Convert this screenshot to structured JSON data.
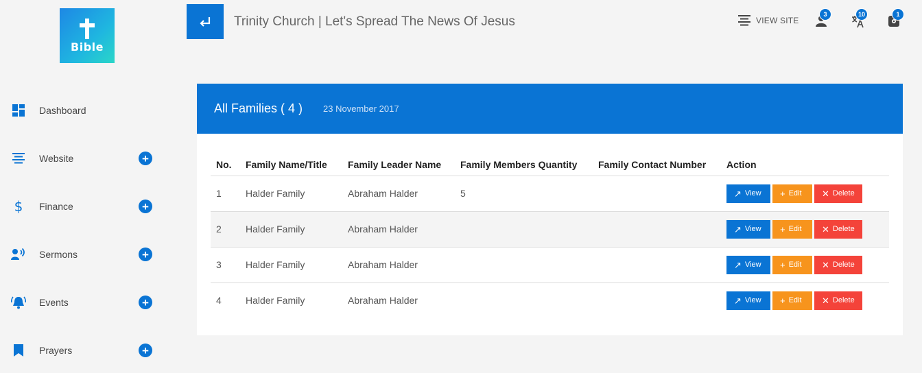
{
  "logo": {
    "text": "Bible"
  },
  "header": {
    "title": "Trinity Church | Let's Spread The News Of Jesus",
    "view_site": "VIEW SITE",
    "badges": {
      "users": "3",
      "translate": "10",
      "settings": "1"
    }
  },
  "sidebar": {
    "items": [
      {
        "label": "Dashboard",
        "icon": "dashboard-icon",
        "has_add": false
      },
      {
        "label": "Website",
        "icon": "align-center-icon",
        "has_add": true
      },
      {
        "label": "Finance",
        "icon": "dollar-icon",
        "has_add": true
      },
      {
        "label": "Sermons",
        "icon": "speaker-icon",
        "has_add": true
      },
      {
        "label": "Events",
        "icon": "alarm-bell-icon",
        "has_add": true
      },
      {
        "label": "Prayers",
        "icon": "bookmark-icon",
        "has_add": true
      }
    ]
  },
  "card": {
    "title": "All Families ( 4 )",
    "date": "23 November 2017"
  },
  "table": {
    "headers": [
      "No.",
      "Family Name/Title",
      "Family Leader Name",
      "Family Members Quantity",
      "Family Contact Number",
      "Action"
    ],
    "rows": [
      {
        "no": "1",
        "name": "Halder Family",
        "leader": "Abraham Halder",
        "qty": "5",
        "contact": ""
      },
      {
        "no": "2",
        "name": "Halder Family",
        "leader": "Abraham Halder",
        "qty": "",
        "contact": ""
      },
      {
        "no": "3",
        "name": "Halder Family",
        "leader": "Abraham Halder",
        "qty": "",
        "contact": ""
      },
      {
        "no": "4",
        "name": "Halder Family",
        "leader": "Abraham Halder",
        "qty": "",
        "contact": ""
      }
    ],
    "actions": {
      "view": "View",
      "edit": "Edit",
      "delete": "Delete"
    }
  },
  "colors": {
    "primary": "#0a74d4",
    "edit": "#f7941d",
    "delete": "#f4433a",
    "background": "#f4f4f4"
  }
}
